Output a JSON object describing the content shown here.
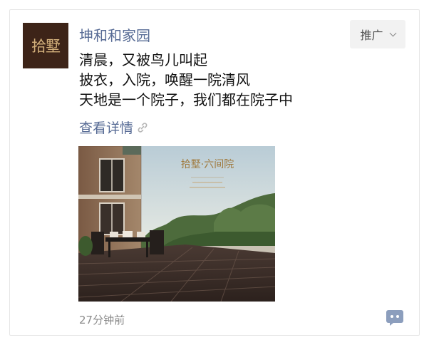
{
  "post": {
    "avatar_text": "拾墅",
    "account_name": "坤和和家园",
    "promo_label": "推广",
    "lines": [
      "清晨，又被鸟儿叫起",
      "披衣，入院，唤醒一院清风",
      "天地是一个院子，我们都在院子中"
    ],
    "detail_link": "查看详情",
    "image_title": "拾墅·六间院",
    "timestamp": "27分钟前"
  },
  "colors": {
    "link": "#576b95",
    "avatar_bg": "#3d2418",
    "avatar_text": "#d3b07b",
    "comment_icon": "#8c9ebd"
  },
  "icons": [
    "link-icon",
    "chevron-down-icon",
    "comment-icon"
  ]
}
